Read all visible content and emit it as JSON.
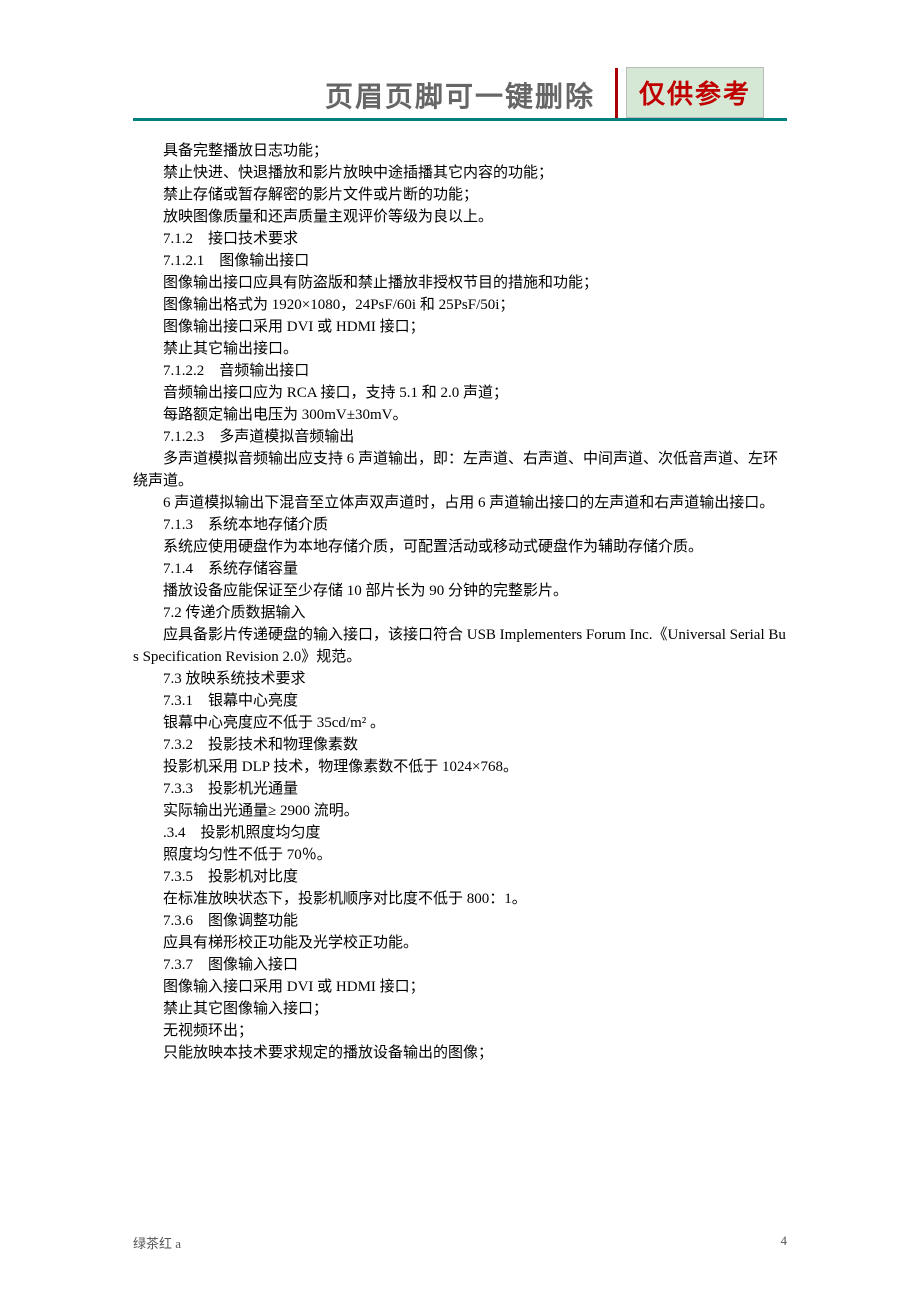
{
  "header": {
    "title": "页眉页脚可一键删除",
    "stamp": "仅供参考"
  },
  "body": {
    "lines": [
      "具备完整播放日志功能；",
      "禁止快进、快退播放和影片放映中途插播其它内容的功能；",
      "禁止存储或暂存解密的影片文件或片断的功能；",
      "放映图像质量和还声质量主观评价等级为良以上。",
      "7.1.2　接口技术要求",
      "7.1.2.1　图像输出接口",
      "图像输出接口应具有防盗版和禁止播放非授权节目的措施和功能；",
      "图像输出格式为 1920×1080，24PsF/60i 和 25PsF/50i；",
      "图像输出接口采用 DVI 或 HDMI 接口；",
      "禁止其它输出接口。",
      "7.1.2.2　音频输出接口",
      "音频输出接口应为 RCA 接口，支持 5.1 和 2.0 声道；",
      "每路额定输出电压为 300mV±30mV。",
      "7.1.2.3　多声道模拟音频输出",
      "多声道模拟音频输出应支持 6 声道输出，即：左声道、右声道、中间声道、次低音声道、左环绕声道。",
      "6 声道模拟输出下混音至立体声双声道时，占用 6 声道输出接口的左声道和右声道输出接口。",
      "7.1.3　系统本地存储介质",
      "系统应使用硬盘作为本地存储介质，可配置活动或移动式硬盘作为辅助存储介质。",
      "7.1.4　系统存储容量",
      "播放设备应能保证至少存储 10 部片长为 90 分钟的完整影片。",
      "7.2 传递介质数据输入",
      "应具备影片传递硬盘的输入接口，该接口符合 USB Implementers Forum Inc.《Universal Serial Bus Specification Revision 2.0》规范。",
      "7.3 放映系统技术要求",
      "7.3.1　银幕中心亮度",
      "银幕中心亮度应不低于 35cd/m² 。",
      "7.3.2　投影技术和物理像素数",
      "投影机采用 DLP 技术，物理像素数不低于 1024×768。",
      "7.3.3　投影机光通量",
      "实际输出光通量≥ 2900 流明。",
      ".3.4　投影机照度均匀度",
      "照度均匀性不低于 70％。",
      "7.3.5　投影机对比度",
      "在标准放映状态下，投影机顺序对比度不低于 800：1。",
      "7.3.6　图像调整功能",
      "应具有梯形校正功能及光学校正功能。",
      "7.3.7　图像输入接口",
      "图像输入接口采用 DVI 或 HDMI 接口；",
      "禁止其它图像输入接口；",
      "无视频环出；",
      "只能放映本技术要求规定的播放设备输出的图像；"
    ]
  },
  "footer": {
    "left": "绿茶红 a",
    "right": "4"
  }
}
